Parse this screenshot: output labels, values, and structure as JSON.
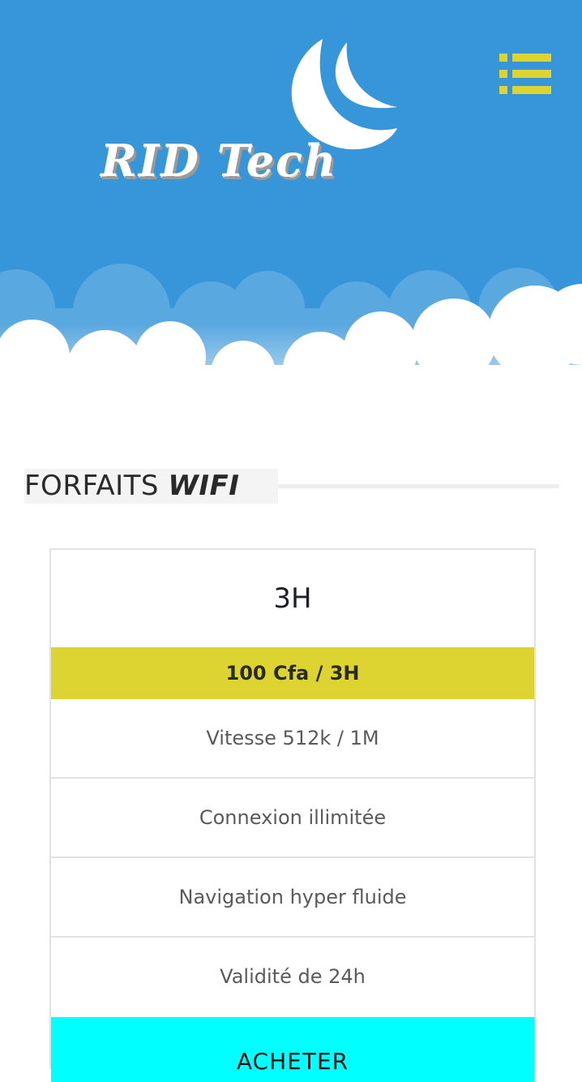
{
  "header": {
    "logo_text": "RID Tech",
    "colors": {
      "sky": "#3796d9",
      "accent": "#ddd431",
      "cloud": "#ffffff"
    },
    "menu_icon": "list-menu-icon"
  },
  "section": {
    "title_light": "FORFAITS ",
    "title_emphasis": "WIFI"
  },
  "plan": {
    "name": "3H",
    "price": "100 Cfa / 3H",
    "features": [
      "Vitesse 512k / 1M",
      "Connexion illimitée",
      "Navigation hyper fluide",
      "Validité de 24h"
    ],
    "buy_label": "ACHETER",
    "colors": {
      "price_band": "#ddd431",
      "buy_button": "#00ffff"
    }
  }
}
